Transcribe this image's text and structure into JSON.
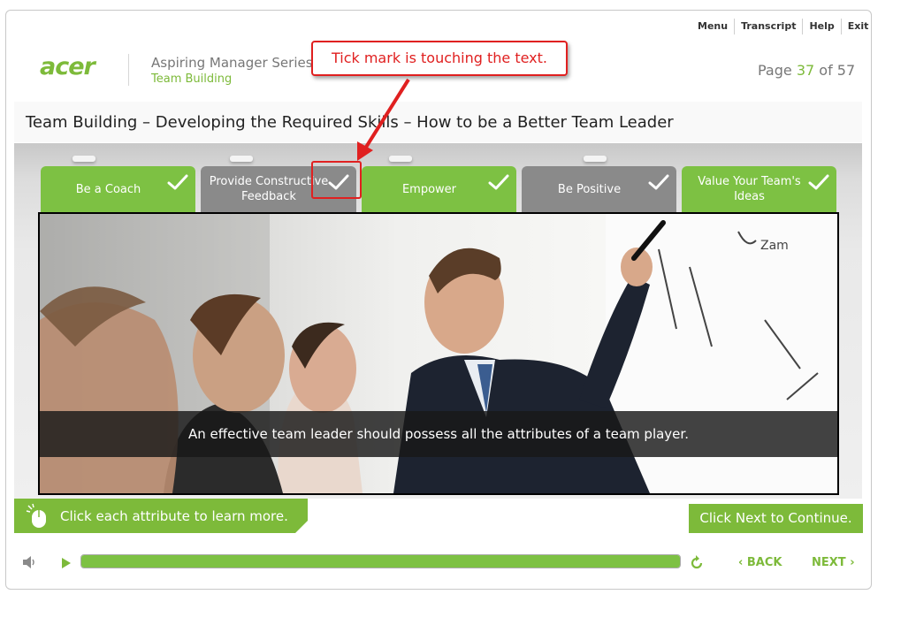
{
  "topmenu": [
    "Menu",
    "Transcript",
    "Help",
    "Exit"
  ],
  "header": {
    "logo_text": "acer",
    "series": "Aspiring Manager Series",
    "subseries": "Team Building",
    "page_prefix": "Page",
    "page_current": "37",
    "page_of": "of",
    "page_total": "57"
  },
  "title": "Team Building – Developing the Required Skills – How to be a Better Team Leader",
  "tabs": [
    {
      "label": "Be a Coach",
      "state": "green"
    },
    {
      "label": "Provide Constructive Feedback",
      "state": "grey"
    },
    {
      "label": "Empower",
      "state": "green"
    },
    {
      "label": "Be Positive",
      "state": "grey"
    },
    {
      "label": "Value Your Team's Ideas",
      "state": "green"
    }
  ],
  "caption": "An effective team leader should possess all the attributes of a team player.",
  "instruction": "Click each attribute to learn more.",
  "next_message": "Click Next to Continue.",
  "player": {
    "progress_fraction": 1.0,
    "back_label": "BACK",
    "next_label": "NEXT"
  },
  "annotation": {
    "text": "Tick mark is touching the text."
  },
  "colors": {
    "accent_green": "#7dba3a",
    "tab_green": "#7dc143",
    "tab_grey": "#8a8a8a",
    "annotation_red": "#e02020"
  }
}
